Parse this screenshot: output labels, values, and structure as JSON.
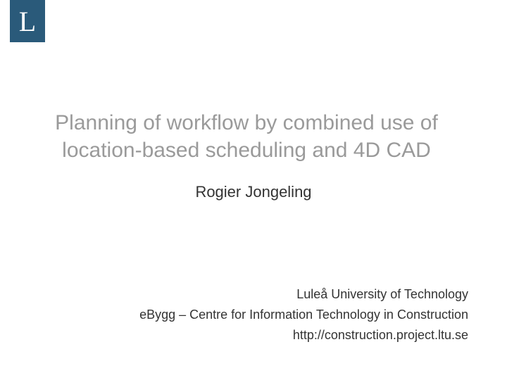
{
  "logo": {
    "letter": "L"
  },
  "title": "Planning of workflow by combined use of location-based scheduling and 4D CAD",
  "author": "Rogier Jongeling",
  "affiliation": {
    "line1": "Luleå University of Technology",
    "line2": "eBygg – Centre for Information Technology in Construction",
    "line3": "http://construction.project.ltu.se"
  }
}
